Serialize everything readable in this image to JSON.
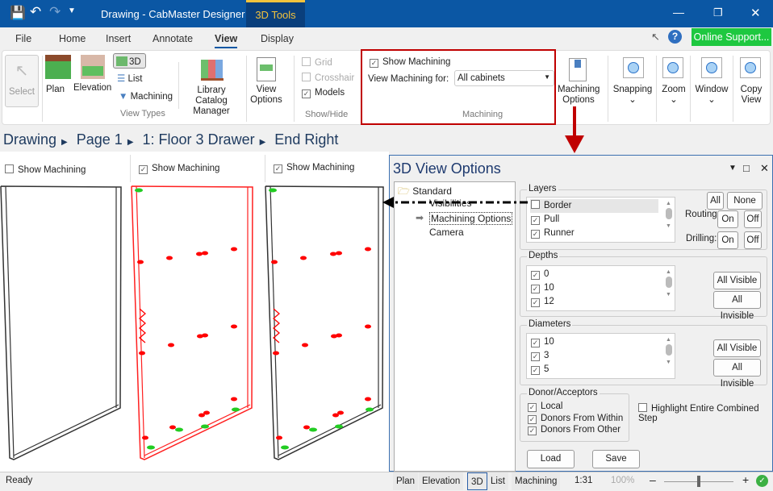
{
  "window": {
    "title": "Drawing - CabMaster Designer",
    "context_tab": "3D Tools"
  },
  "menu": [
    "File",
    "Home",
    "Insert",
    "Annotate",
    "View",
    "Display"
  ],
  "online_support": "Online Support...",
  "ribbon": {
    "select": "Select",
    "plan": "Plan",
    "elevation": "Elevation",
    "view3d": "3D",
    "list": "List",
    "machining": "Machining",
    "library_catalog_manager": [
      "Library Catalog",
      "Manager"
    ],
    "view_types_group": "View Types",
    "view_options": [
      "View",
      "Options"
    ],
    "grid": "Grid",
    "crosshair": "Crosshair",
    "models": "Models",
    "show_hide_group": "Show/Hide",
    "show_machining": "Show Machining",
    "show_machining_checked": true,
    "view_machining_for_label": "View Machining for:",
    "view_machining_for_value": "All cabinets",
    "machining_group": "Machining",
    "machining_options": [
      "Machining",
      "Options"
    ],
    "snapping": "Snapping",
    "zoom": "Zoom",
    "window": "Window",
    "copy_view": [
      "Copy",
      "View"
    ]
  },
  "breadcrumb": [
    "Drawing",
    "Page 1",
    "1: Floor 3 Drawer",
    "End Right"
  ],
  "panels": [
    {
      "label": "Show Machining",
      "checked": false
    },
    {
      "label": "Show Machining",
      "checked": true
    },
    {
      "label": "Show Machining",
      "checked": true
    }
  ],
  "dialog": {
    "title": "3D View Options",
    "tree": {
      "root": "Standard",
      "items": [
        "Visibilities",
        "Machining Options",
        "Camera"
      ],
      "selected": "Machining Options"
    },
    "layers": {
      "legend": "Layers",
      "items": [
        {
          "label": "Border",
          "checked": false
        },
        {
          "label": "Pull",
          "checked": true
        },
        {
          "label": "Runner",
          "checked": true
        }
      ],
      "all": "All",
      "none": "None",
      "routing": "Routing:",
      "drilling": "Drilling:",
      "on": "On",
      "off": "Off"
    },
    "depths": {
      "legend": "Depths",
      "items": [
        "0",
        "10",
        "12"
      ],
      "all_visible": "All Visible",
      "all_invisible": "All Invisible"
    },
    "diameters": {
      "legend": "Diameters",
      "items": [
        "10",
        "3",
        "5"
      ],
      "all_visible": "All Visible",
      "all_invisible": "All Invisible"
    },
    "donor": {
      "legend": "Donor/Acceptors",
      "items": [
        "Local",
        "Donors From Within",
        "Donors From Other"
      ]
    },
    "highlight": "Highlight Entire Combined Step",
    "load": "Load",
    "save": "Save"
  },
  "status": {
    "ready": "Ready",
    "views": [
      "Plan",
      "Elevation",
      "3D",
      "List",
      "Machining"
    ],
    "active_view": "3D",
    "scale": "1:31",
    "zoom": "100%"
  },
  "colors": {
    "titlebar": "#0b57a4",
    "highlight_box": "#c00000",
    "machining_red": "#ff0000",
    "machining_green": "#22cc22",
    "support": "#1ec840"
  }
}
